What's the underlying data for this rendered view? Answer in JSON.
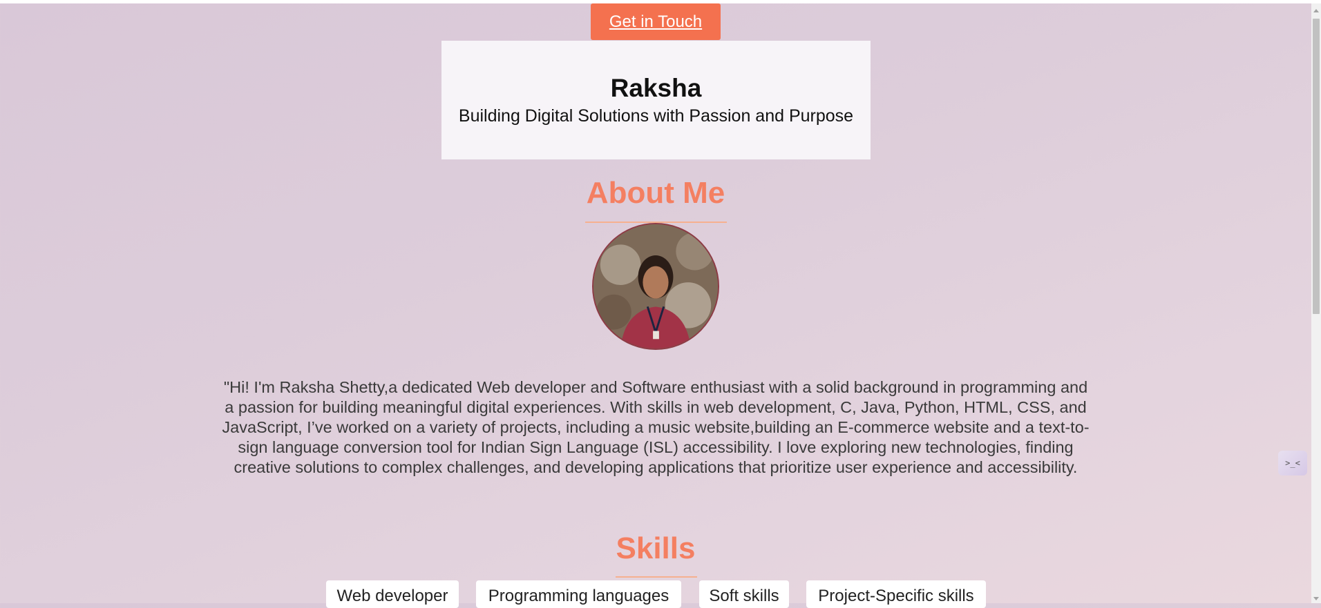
{
  "header": {
    "cta_label": "Get in Touch",
    "name": "Raksha",
    "tagline": "Building Digital Solutions with Passion and Purpose"
  },
  "about": {
    "title": "About Me",
    "bio": "\"Hi! I'm Raksha Shetty,a dedicated Web developer and Software enthusiast with a solid background in programming and a passion for building meaningful digital experiences. With skills in web development, C, Java, Python, HTML, CSS, and JavaScript, I’ve worked on a variety of projects, including a music website,building an E-commerce website and a text-to-sign language conversion tool for Indian Sign Language (ISL) accessibility. I love exploring new technologies, finding creative solutions to complex challenges, and developing applications that prioritize user experience and accessibility."
  },
  "skills": {
    "title": "Skills",
    "tabs": [
      {
        "label": "Web developer"
      },
      {
        "label": "Programming languages"
      },
      {
        "label": "Soft skills"
      },
      {
        "label": "Project-Specific skills"
      }
    ]
  },
  "widget": {
    "glyph": ">_<"
  },
  "colors": {
    "accent": "#f47f61",
    "button": "#f4714f",
    "card": "#f7f4f8",
    "text": "#3a3a3a"
  }
}
